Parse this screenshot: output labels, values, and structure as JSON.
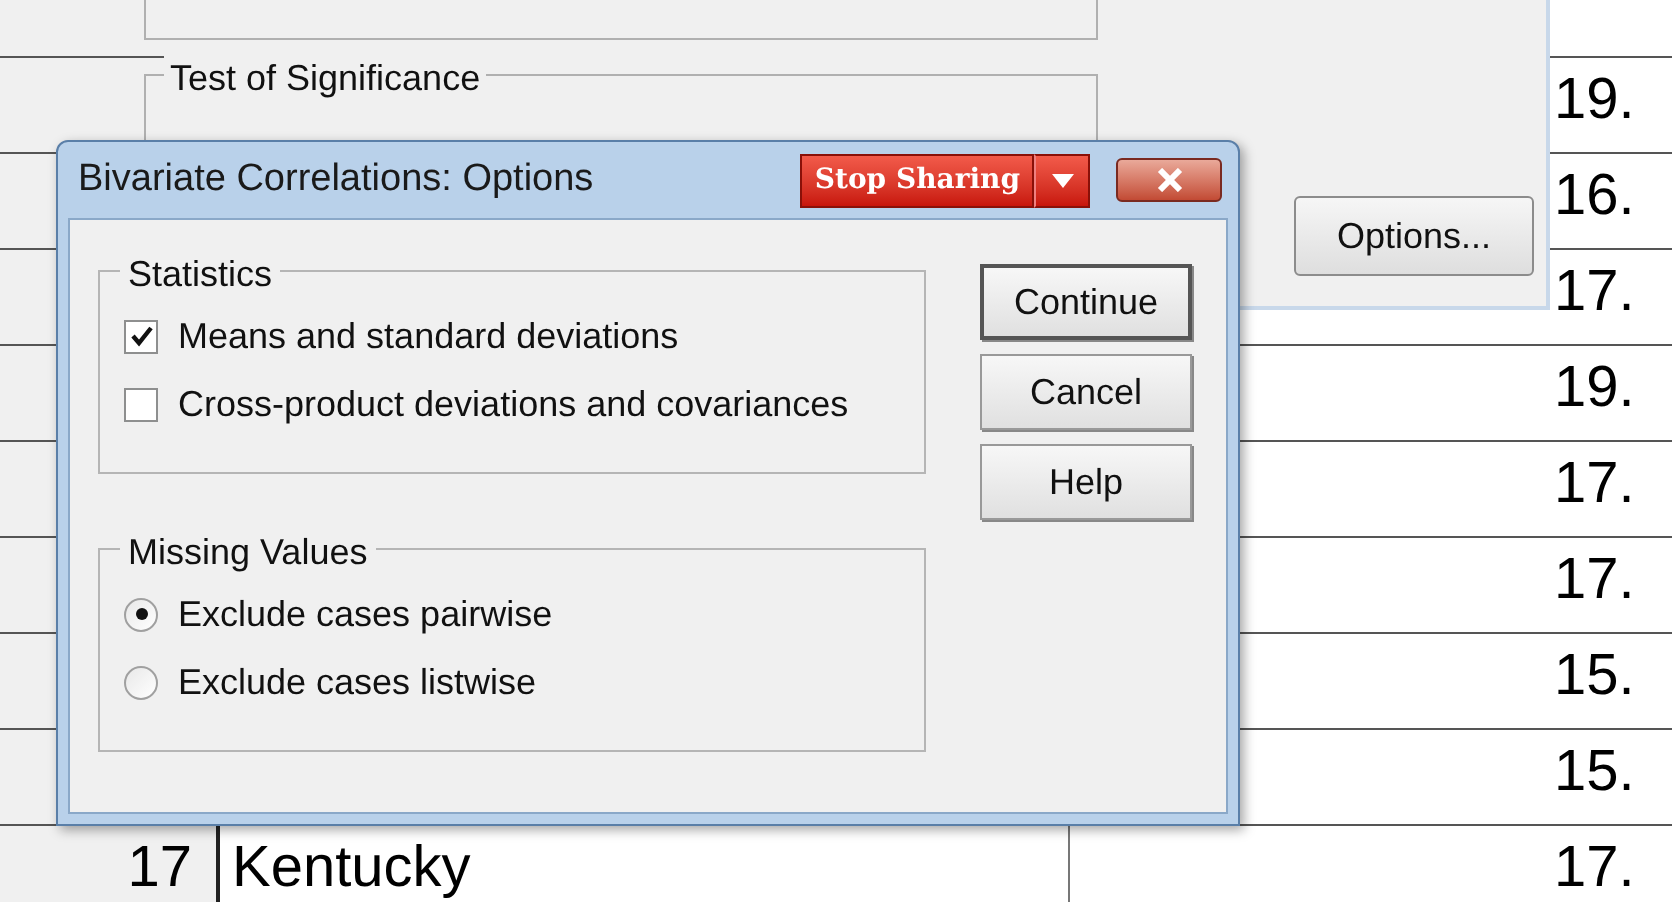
{
  "sheet": {
    "rows": [
      {
        "row_number": "",
        "name": "",
        "value": "19."
      },
      {
        "row_number": "",
        "name": "",
        "value": "16."
      },
      {
        "row_number": "",
        "name": "",
        "value": "17."
      },
      {
        "row_number": "",
        "name": "",
        "value": "19."
      },
      {
        "row_number": "",
        "name": "",
        "value": "17."
      },
      {
        "row_number": "",
        "name": "",
        "value": "17."
      },
      {
        "row_number": "",
        "name": "",
        "value": "15."
      },
      {
        "row_number": "",
        "name": "",
        "value": "15."
      },
      {
        "row_number": "17",
        "name": "Kentucky",
        "value": "17."
      }
    ]
  },
  "parent_dialog": {
    "group_title": "Test of Significance",
    "options_button": "Options..."
  },
  "dialog": {
    "title": "Bivariate Correlations: Options",
    "stop_sharing": "Stop Sharing",
    "groups": [
      {
        "title": "Statistics",
        "items": [
          {
            "kind": "checkbox",
            "label": "Means and standard deviations",
            "checked": true
          },
          {
            "kind": "checkbox",
            "label": "Cross-product deviations and covariances",
            "checked": false
          }
        ]
      },
      {
        "title": "Missing Values",
        "items": [
          {
            "kind": "radio",
            "label": "Exclude cases pairwise",
            "selected": true
          },
          {
            "kind": "radio",
            "label": "Exclude cases listwise",
            "selected": false
          }
        ]
      }
    ],
    "buttons": [
      {
        "label": "Continue",
        "default": true
      },
      {
        "label": "Cancel",
        "default": false
      },
      {
        "label": "Help",
        "default": false
      }
    ]
  }
}
